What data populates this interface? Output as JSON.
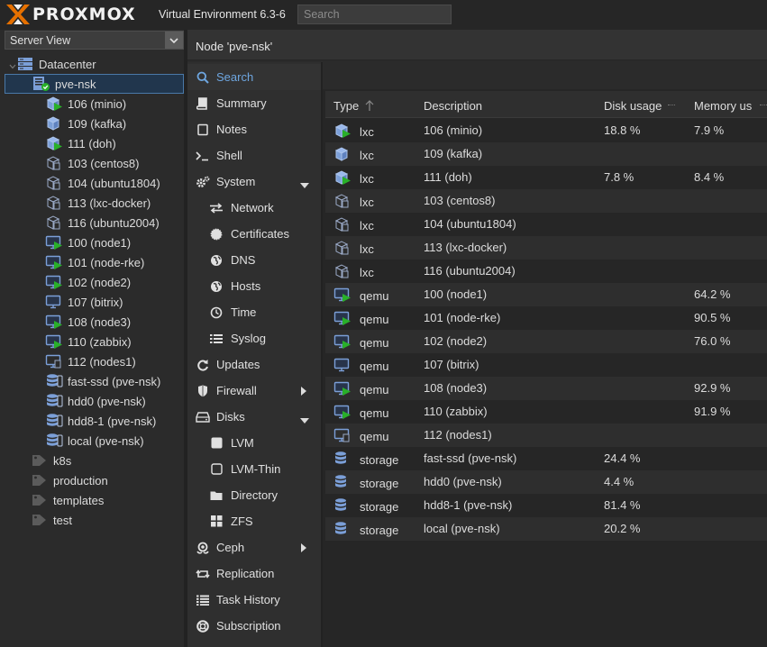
{
  "header": {
    "logo_text": "PROXMOX",
    "version": "Virtual Environment 6.3-6",
    "search_placeholder": "Search"
  },
  "tree": {
    "view_select": "Server View",
    "datacenter": "Datacenter",
    "node": "pve-nsk",
    "guests": [
      {
        "label": "106 (minio)",
        "kind": "lxc",
        "running": true
      },
      {
        "label": "109 (kafka)",
        "kind": "lxc",
        "running": false
      },
      {
        "label": "111 (doh)",
        "kind": "lxc",
        "running": true
      },
      {
        "label": "103 (centos8)",
        "kind": "lxc-template",
        "running": false
      },
      {
        "label": "104 (ubuntu1804)",
        "kind": "lxc-template",
        "running": false
      },
      {
        "label": "113 (lxc-docker)",
        "kind": "lxc-template",
        "running": false
      },
      {
        "label": "116 (ubuntu2004)",
        "kind": "lxc-template",
        "running": false
      },
      {
        "label": "100 (node1)",
        "kind": "qemu",
        "running": true
      },
      {
        "label": "101 (node-rke)",
        "kind": "qemu",
        "running": true
      },
      {
        "label": "102 (node2)",
        "kind": "qemu",
        "running": true
      },
      {
        "label": "107 (bitrix)",
        "kind": "qemu",
        "running": false
      },
      {
        "label": "108 (node3)",
        "kind": "qemu",
        "running": true
      },
      {
        "label": "110 (zabbix)",
        "kind": "qemu",
        "running": true
      },
      {
        "label": "112 (nodes1)",
        "kind": "qemu-template",
        "running": false
      },
      {
        "label": "fast-ssd (pve-nsk)",
        "kind": "storage",
        "running": false
      },
      {
        "label": "hdd0 (pve-nsk)",
        "kind": "storage",
        "running": false
      },
      {
        "label": "hdd8-1 (pve-nsk)",
        "kind": "storage",
        "running": false
      },
      {
        "label": "local (pve-nsk)",
        "kind": "storage",
        "running": false
      }
    ],
    "tags": [
      "k8s",
      "production",
      "templates",
      "test"
    ]
  },
  "node_header": "Node 'pve-nsk'",
  "nav": [
    {
      "label": "Search",
      "icon": "search-icon",
      "active": true,
      "sub": false,
      "arrow": ""
    },
    {
      "label": "Summary",
      "icon": "book-icon",
      "active": false,
      "sub": false,
      "arrow": ""
    },
    {
      "label": "Notes",
      "icon": "notes-icon",
      "active": false,
      "sub": false,
      "arrow": ""
    },
    {
      "label": "Shell",
      "icon": "terminal-icon",
      "active": false,
      "sub": false,
      "arrow": ""
    },
    {
      "label": "System",
      "icon": "cogs-icon",
      "active": false,
      "sub": false,
      "arrow": "down"
    },
    {
      "label": "Network",
      "icon": "exchange-icon",
      "active": false,
      "sub": true,
      "arrow": ""
    },
    {
      "label": "Certificates",
      "icon": "certificate-icon",
      "active": false,
      "sub": true,
      "arrow": ""
    },
    {
      "label": "DNS",
      "icon": "globe-icon",
      "active": false,
      "sub": true,
      "arrow": ""
    },
    {
      "label": "Hosts",
      "icon": "globe-icon",
      "active": false,
      "sub": true,
      "arrow": ""
    },
    {
      "label": "Time",
      "icon": "clock-icon",
      "active": false,
      "sub": true,
      "arrow": ""
    },
    {
      "label": "Syslog",
      "icon": "list-icon",
      "active": false,
      "sub": true,
      "arrow": ""
    },
    {
      "label": "Updates",
      "icon": "refresh-icon",
      "active": false,
      "sub": false,
      "arrow": ""
    },
    {
      "label": "Firewall",
      "icon": "shield-icon",
      "active": false,
      "sub": false,
      "arrow": "right"
    },
    {
      "label": "Disks",
      "icon": "hdd-icon",
      "active": false,
      "sub": false,
      "arrow": "down"
    },
    {
      "label": "LVM",
      "icon": "square-icon",
      "active": false,
      "sub": true,
      "arrow": ""
    },
    {
      "label": "LVM-Thin",
      "icon": "square-outline-icon",
      "active": false,
      "sub": true,
      "arrow": ""
    },
    {
      "label": "Directory",
      "icon": "folder-icon",
      "active": false,
      "sub": true,
      "arrow": ""
    },
    {
      "label": "ZFS",
      "icon": "grid-icon",
      "active": false,
      "sub": true,
      "arrow": ""
    },
    {
      "label": "Ceph",
      "icon": "ceph-icon",
      "active": false,
      "sub": false,
      "arrow": "right"
    },
    {
      "label": "Replication",
      "icon": "retweet-icon",
      "active": false,
      "sub": false,
      "arrow": ""
    },
    {
      "label": "Task History",
      "icon": "list-alt-icon",
      "active": false,
      "sub": false,
      "arrow": ""
    },
    {
      "label": "Subscription",
      "icon": "support-icon",
      "active": false,
      "sub": false,
      "arrow": ""
    }
  ],
  "grid": {
    "columns": [
      "Type",
      "Description",
      "Disk usage",
      "Memory us"
    ],
    "rows": [
      {
        "type": "lxc",
        "desc": "106 (minio)",
        "disk": "18.8 %",
        "mem": "7.9 %",
        "kind": "lxc",
        "running": true
      },
      {
        "type": "lxc",
        "desc": "109 (kafka)",
        "disk": "",
        "mem": "",
        "kind": "lxc",
        "running": false
      },
      {
        "type": "lxc",
        "desc": "111 (doh)",
        "disk": "7.8 %",
        "mem": "8.4 %",
        "kind": "lxc",
        "running": true
      },
      {
        "type": "lxc",
        "desc": "103 (centos8)",
        "disk": "",
        "mem": "",
        "kind": "lxc-template",
        "running": false
      },
      {
        "type": "lxc",
        "desc": "104 (ubuntu1804)",
        "disk": "",
        "mem": "",
        "kind": "lxc-template",
        "running": false
      },
      {
        "type": "lxc",
        "desc": "113 (lxc-docker)",
        "disk": "",
        "mem": "",
        "kind": "lxc-template",
        "running": false
      },
      {
        "type": "lxc",
        "desc": "116 (ubuntu2004)",
        "disk": "",
        "mem": "",
        "kind": "lxc-template",
        "running": false
      },
      {
        "type": "qemu",
        "desc": "100 (node1)",
        "disk": "",
        "mem": "64.2 %",
        "kind": "qemu",
        "running": true
      },
      {
        "type": "qemu",
        "desc": "101 (node-rke)",
        "disk": "",
        "mem": "90.5 %",
        "kind": "qemu",
        "running": true
      },
      {
        "type": "qemu",
        "desc": "102 (node2)",
        "disk": "",
        "mem": "76.0 %",
        "kind": "qemu",
        "running": true
      },
      {
        "type": "qemu",
        "desc": "107 (bitrix)",
        "disk": "",
        "mem": "",
        "kind": "qemu",
        "running": false
      },
      {
        "type": "qemu",
        "desc": "108 (node3)",
        "disk": "",
        "mem": "92.9 %",
        "kind": "qemu",
        "running": true
      },
      {
        "type": "qemu",
        "desc": "110 (zabbix)",
        "disk": "",
        "mem": "91.9 %",
        "kind": "qemu",
        "running": true
      },
      {
        "type": "qemu",
        "desc": "112 (nodes1)",
        "disk": "",
        "mem": "",
        "kind": "qemu-template",
        "running": false
      },
      {
        "type": "storage",
        "desc": "fast-ssd (pve-nsk)",
        "disk": "24.4 %",
        "mem": "",
        "kind": "storage",
        "running": false
      },
      {
        "type": "storage",
        "desc": "hdd0 (pve-nsk)",
        "disk": "4.4 %",
        "mem": "",
        "kind": "storage",
        "running": false
      },
      {
        "type": "storage",
        "desc": "hdd8-1 (pve-nsk)",
        "disk": "81.4 %",
        "mem": "",
        "kind": "storage",
        "running": false
      },
      {
        "type": "storage",
        "desc": "local (pve-nsk)",
        "disk": "20.2 %",
        "mem": "",
        "kind": "storage",
        "running": false
      }
    ]
  },
  "colors": {
    "accent": "#6ea6e0",
    "brand_orange": "#e57000",
    "running_green": "#29b029",
    "icon_blue": "#7b9fd8"
  }
}
